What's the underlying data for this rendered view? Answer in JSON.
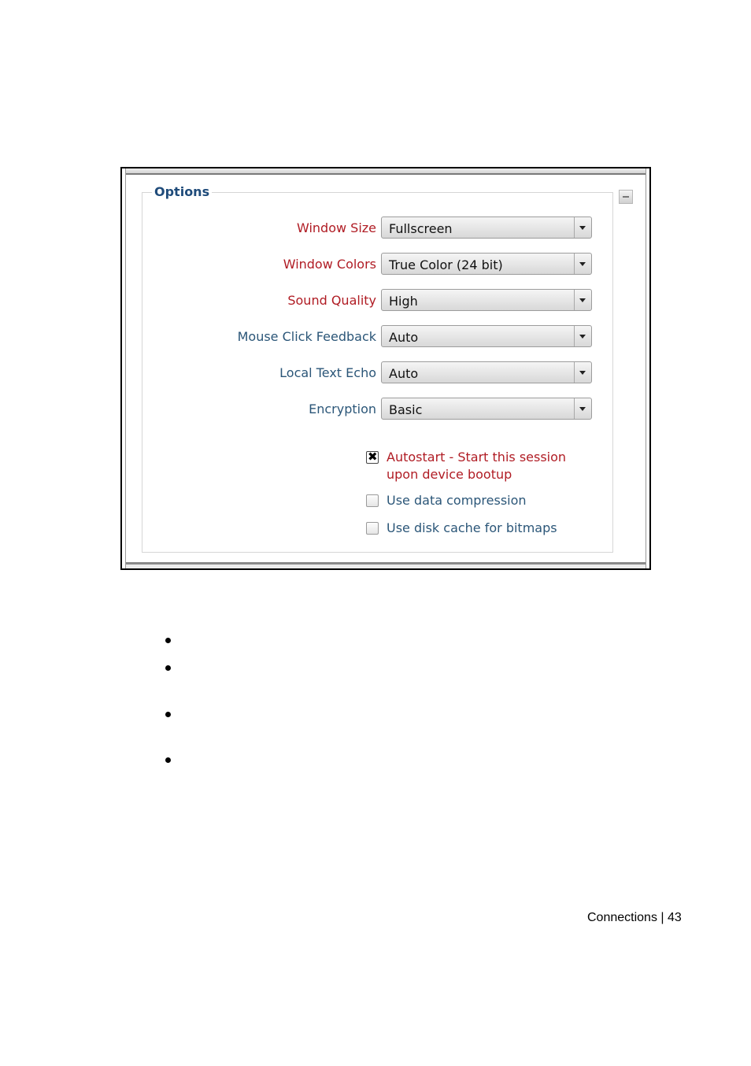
{
  "options_panel": {
    "legend": "Options",
    "collapse_icon": "minus-square-icon",
    "fields": [
      {
        "label": "Window Size",
        "value": "Fullscreen",
        "required": true
      },
      {
        "label": "Window Colors",
        "value": "True Color (24 bit)",
        "required": true
      },
      {
        "label": "Sound Quality",
        "value": "High",
        "required": true
      },
      {
        "label": "Mouse Click Feedback",
        "value": "Auto",
        "required": false
      },
      {
        "label": "Local Text Echo",
        "value": "Auto",
        "required": false
      },
      {
        "label": "Encryption",
        "value": "Basic",
        "required": false
      }
    ],
    "checkboxes": [
      {
        "label_line1": "Autostart - Start this session",
        "label_line2": "upon device bootup",
        "checked": true,
        "check_glyph": "✖"
      },
      {
        "label": "Use data compression",
        "checked": false
      },
      {
        "label": "Use disk cache for bitmaps",
        "checked": false
      }
    ]
  },
  "bullets_count": 4,
  "footer": {
    "text": "Connections | 43"
  }
}
